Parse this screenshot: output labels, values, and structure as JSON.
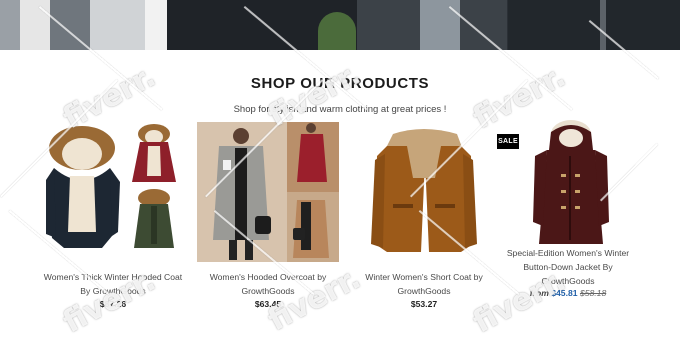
{
  "section": {
    "heading": "SHOP OUR PRODUCTS",
    "subheading": "Shop for stylish and warm clothing at great prices !"
  },
  "products": [
    {
      "title_line1": "Women's Thick Winter Hooded Coat",
      "title_line2": "By GrowthGoods",
      "price": "$87.26"
    },
    {
      "title_line1": "Women's Hooded Overcoat by",
      "title_line2": "GrowthGoods",
      "price": "$63.45"
    },
    {
      "title_line1": "Winter Women's Short Coat by",
      "title_line2": "GrowthGoods",
      "price": "$53.27"
    },
    {
      "badge": "SALE",
      "title_line1": "Special-Edition Women's Winter",
      "title_line2": "Button-Down Jacket By",
      "title_line3": "GrowthGoods",
      "price_prefix": "from",
      "price": "$45.81",
      "compare_price": "$58.18"
    }
  ],
  "watermark": "fiverr."
}
